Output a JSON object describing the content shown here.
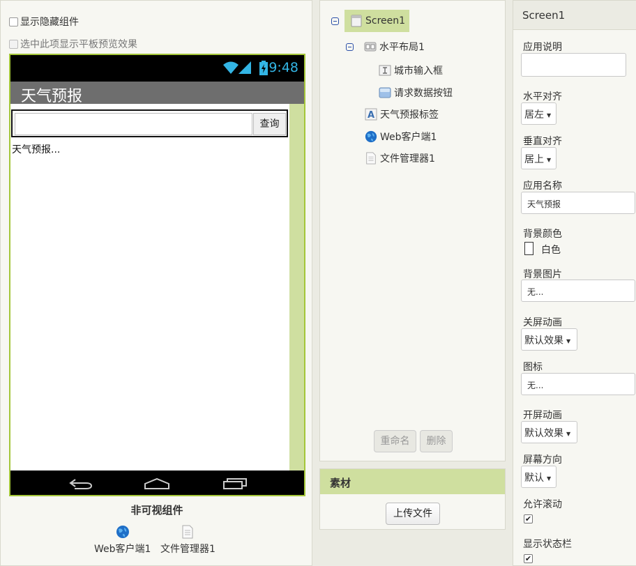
{
  "viewer": {
    "show_hidden_label": "显示隐藏组件",
    "tablet_preview_label": "选中此项显示平板预览效果",
    "status_time": "9:48",
    "app_title": "天气预报",
    "query_button": "查询",
    "weather_label": "天气预报...",
    "nonvisible_title": "非可视组件",
    "nonvisible_components": [
      "Web客户端1",
      "文件管理器1"
    ]
  },
  "components": {
    "tree": [
      {
        "label": "Screen1",
        "icon": "screen-icon",
        "level": 0,
        "selected": true
      },
      {
        "label": "水平布局1",
        "icon": "horizontal-arrangement-icon",
        "level": 1
      },
      {
        "label": "城市输入框",
        "icon": "textbox-icon",
        "level": 2
      },
      {
        "label": "请求数据按钮",
        "icon": "button-icon",
        "level": 2
      },
      {
        "label": "天气预报标签",
        "icon": "label-icon",
        "level": 1
      },
      {
        "label": "Web客户端1",
        "icon": "web-icon",
        "level": 1
      },
      {
        "label": "文件管理器1",
        "icon": "file-icon",
        "level": 1
      }
    ],
    "rename_button": "重命名",
    "delete_button": "删除"
  },
  "media": {
    "header": "素材",
    "upload_button": "上传文件"
  },
  "properties": {
    "header": "Screen1",
    "about_screen_label": "应用说明",
    "align_horizontal_label": "水平对齐",
    "align_horizontal_value": "居左",
    "align_vertical_label": "垂直对齐",
    "align_vertical_value": "居上",
    "app_name_label": "应用名称",
    "app_name_value": "天气预报",
    "bg_color_label": "背景颜色",
    "bg_color_value": "白色",
    "bg_image_label": "背景图片",
    "bg_image_value": "无...",
    "close_anim_label": "关屏动画",
    "close_anim_value": "默认效果",
    "icon_label": "图标",
    "icon_value": "无...",
    "open_anim_label": "开屏动画",
    "open_anim_value": "默认效果",
    "orientation_label": "屏幕方向",
    "orientation_value": "默认",
    "scrollable_label": "允许滚动",
    "scrollable_checked": true,
    "show_statusbar_label": "显示状态栏",
    "show_statusbar_checked": true
  },
  "colors": {
    "accent_green": "#cfdf9f",
    "phone_border": "#a4c639",
    "status_time_blue": "#33b5e5"
  }
}
